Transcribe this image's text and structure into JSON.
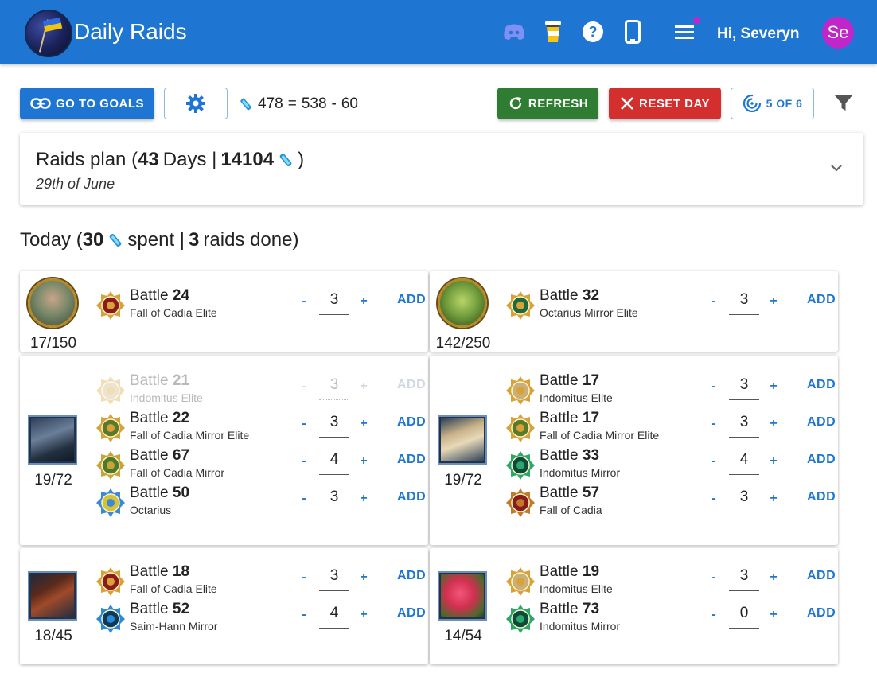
{
  "header": {
    "app_title": "Daily Raids",
    "greeting": "Hi, Severyn",
    "avatar_initials": "Se",
    "icons": [
      "discord-icon",
      "coffee-cup-icon",
      "help-icon",
      "phone-icon",
      "menu-icon"
    ],
    "brand_color": "#1e76d2"
  },
  "toolbar": {
    "goals_label": "GO TO GOALS",
    "energy_left": "478",
    "energy_total": "538",
    "energy_spent": "60",
    "refresh_label": "REFRESH",
    "reset_label": "RESET DAY",
    "progress_label": "5 OF 6"
  },
  "plan": {
    "prefix": "Raids plan (",
    "days": "43",
    "days_word": "Days |",
    "energy": "14104",
    "suffix": ")",
    "date": "29th of June"
  },
  "today": {
    "prefix": "Today (",
    "energy_spent": "30",
    "spent_word": "spent |",
    "raids_done": "3",
    "raids_word": "raids done)"
  },
  "controls": {
    "minus": "-",
    "plus": "+",
    "add": "ADD",
    "battle_word": "Battle"
  },
  "cards": [
    {
      "progress": "17/150",
      "portrait": "space-marine-character",
      "raids": [
        {
          "battle": "24",
          "campaign": "Fall of Cadia Elite",
          "count": "3",
          "icon": "fall-of-cadia-elite-icon",
          "disabled": false
        }
      ]
    },
    {
      "progress": "142/250",
      "portrait": "ork-character",
      "raids": [
        {
          "battle": "32",
          "campaign": "Octarius Mirror Elite",
          "count": "3",
          "icon": "octarius-mirror-elite-icon",
          "disabled": false
        }
      ]
    },
    {
      "progress": "19/72",
      "portrait": "armor-upgrade",
      "raids": [
        {
          "battle": "21",
          "campaign": "Indomitus Elite",
          "count": "3",
          "icon": "indomitus-elite-icon",
          "disabled": true
        },
        {
          "battle": "22",
          "campaign": "Fall of Cadia Mirror Elite",
          "count": "3",
          "icon": "fall-of-cadia-mirror-elite-icon",
          "disabled": false
        },
        {
          "battle": "67",
          "campaign": "Fall of Cadia Mirror",
          "count": "4",
          "icon": "fall-of-cadia-mirror-icon",
          "disabled": false
        },
        {
          "battle": "50",
          "campaign": "Octarius",
          "count": "3",
          "icon": "octarius-icon",
          "disabled": false
        }
      ]
    },
    {
      "progress": "19/72",
      "portrait": "scroll-upgrade",
      "raids": [
        {
          "battle": "17",
          "campaign": "Indomitus Elite",
          "count": "3",
          "icon": "indomitus-elite-icon",
          "disabled": false
        },
        {
          "battle": "17",
          "campaign": "Fall of Cadia Mirror Elite",
          "count": "3",
          "icon": "fall-of-cadia-mirror-elite-icon",
          "disabled": false
        },
        {
          "battle": "33",
          "campaign": "Indomitus Mirror",
          "count": "4",
          "icon": "indomitus-mirror-icon",
          "disabled": false
        },
        {
          "battle": "57",
          "campaign": "Fall of Cadia",
          "count": "3",
          "icon": "fall-of-cadia-icon",
          "disabled": false
        }
      ]
    },
    {
      "progress": "18/45",
      "portrait": "cloak-upgrade",
      "raids": [
        {
          "battle": "18",
          "campaign": "Fall of Cadia Elite",
          "count": "3",
          "icon": "fall-of-cadia-elite-icon",
          "disabled": false
        },
        {
          "battle": "52",
          "campaign": "Saim-Hann Mirror",
          "count": "4",
          "icon": "saim-hann-mirror-icon",
          "disabled": false
        }
      ]
    },
    {
      "progress": "14/54",
      "portrait": "roses-upgrade",
      "raids": [
        {
          "battle": "19",
          "campaign": "Indomitus Elite",
          "count": "3",
          "icon": "indomitus-elite-icon",
          "disabled": false
        },
        {
          "battle": "73",
          "campaign": "Indomitus Mirror",
          "count": "0",
          "icon": "indomitus-mirror-icon",
          "disabled": false
        }
      ]
    }
  ]
}
